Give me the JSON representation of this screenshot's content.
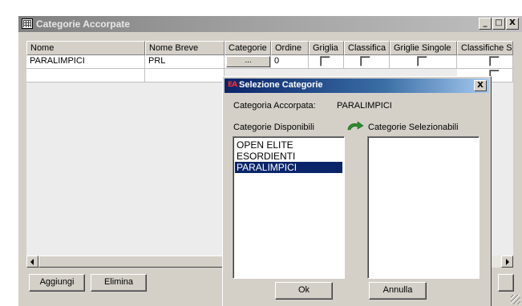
{
  "window": {
    "title": "Categorie Accorpate",
    "controls": {
      "minimize": "_",
      "maximize": "□",
      "close": "X"
    }
  },
  "grid": {
    "columns": [
      "Nome",
      "Nome Breve",
      "Categorie",
      "Ordine",
      "Griglia",
      "Classifica",
      "Griglie Singole",
      "Classifiche Si"
    ],
    "rows": [
      {
        "nome": "PARALIMPICI",
        "nome_breve": "PRL",
        "categorie_button": "...",
        "ordine": "0"
      }
    ]
  },
  "buttons": {
    "add": "Aggiungi",
    "delete": "Elimina"
  },
  "dialog": {
    "title": "Selezione Categorie",
    "brand": "EA",
    "close": "X",
    "merged_label": "Categoria Accorpata:",
    "merged_value": "PARALIMPICI",
    "available_label": "Categorie Disponibili",
    "selectable_label": "Categorie Selezionabili",
    "available_items": [
      "OPEN ELITE",
      "ESORDIENTI",
      "PARALIMPICI"
    ],
    "selected_index": 2,
    "selectable_items": [],
    "ok": "Ok",
    "cancel": "Annulla",
    "swap_icon": "swap-arrow-icon",
    "accent_color": "#0a246a"
  }
}
